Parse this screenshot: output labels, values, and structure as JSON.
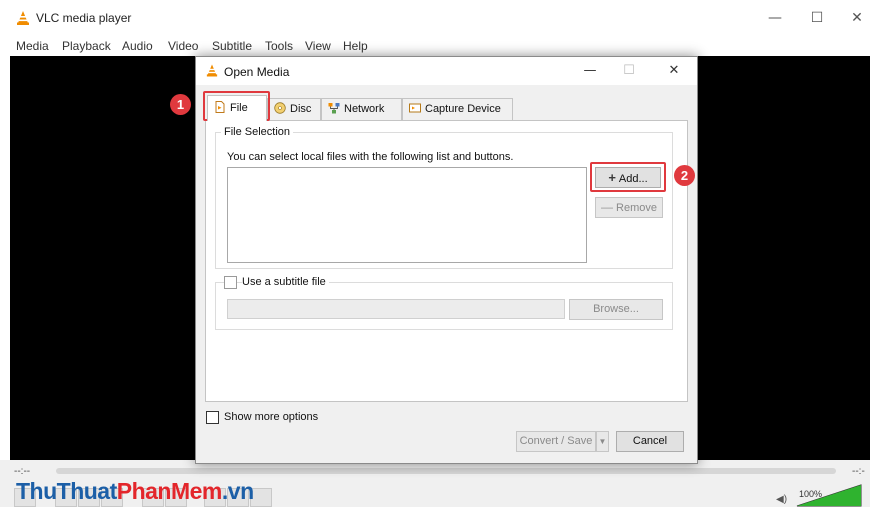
{
  "app": {
    "title": "VLC media player",
    "menu": [
      "Media",
      "Playback",
      "Audio",
      "Video",
      "Subtitle",
      "Tools",
      "View",
      "Help"
    ],
    "controls": {
      "minimize_icon": "minimize-icon",
      "maximize_icon": "maximize-icon",
      "close_icon": "close-icon"
    },
    "seek": {
      "elapsed": "--:--",
      "remaining": "--:-"
    },
    "volume": {
      "label": "100%",
      "level": 1.0
    },
    "watermark": {
      "part1": "ThuThuat",
      "part2": "PhanMem",
      "part3": ".vn"
    }
  },
  "dialog": {
    "title": "Open Media",
    "tabs": [
      {
        "label": "File",
        "icon": "file-icon"
      },
      {
        "label": "Disc",
        "icon": "disc-icon"
      },
      {
        "label": "Network",
        "icon": "network-icon"
      },
      {
        "label": "Capture Device",
        "icon": "capture-device-icon"
      }
    ],
    "file_selection": {
      "group_title": "File Selection",
      "help_text": "You can select local files with the following list and buttons.",
      "add_label": "Add...",
      "remove_label": "Remove"
    },
    "subtitle": {
      "checkbox_label": "Use a subtitle file",
      "browse_label": "Browse..."
    },
    "show_more_label": "Show more options",
    "convert_label": "Convert / Save",
    "cancel_label": "Cancel"
  },
  "annotations": {
    "step1": "1",
    "step2": "2",
    "color": "#e0393e"
  },
  "colors": {
    "video_bg": "#000000",
    "vlc_orange": "#f08c00",
    "watermark_blue": "#1c5fa7",
    "watermark_red": "#e3262b"
  }
}
